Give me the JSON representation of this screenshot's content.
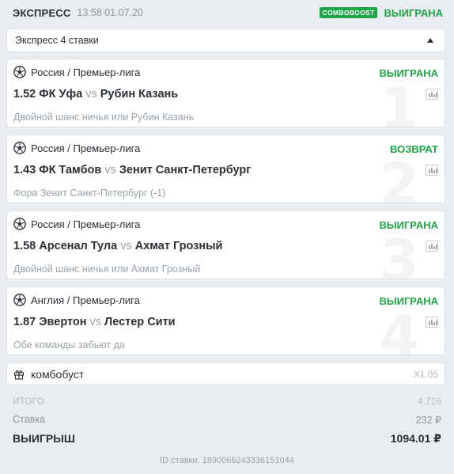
{
  "header": {
    "title": "ЭКСПРЕСС",
    "datetime": "13:58 01.07.20",
    "badge": "COMBOBOOST",
    "result": "ВЫИГРАНА"
  },
  "summary": {
    "label": "Экспресс 4 ставки"
  },
  "events": [
    {
      "index": "1",
      "league": "Россия / Премьер-лига",
      "status": "ВЫИГРАНА",
      "odds": "1.52",
      "home": "ФК Уфа",
      "vs": "vs",
      "away": "Рубин Казань",
      "market": "Двойной шанс ничья или Рубин Казань"
    },
    {
      "index": "2",
      "league": "Россия / Премьер-лига",
      "status": "ВОЗВРАТ",
      "odds": "1.43",
      "home": "ФК Тамбов",
      "vs": "vs",
      "away": "Зенит Санкт-Петербург",
      "market": "Фора Зенит Санкт-Петербург (-1)"
    },
    {
      "index": "3",
      "league": "Россия / Премьер-лига",
      "status": "ВЫИГРАНА",
      "odds": "1.58",
      "home": "Арсенал Тула",
      "vs": "vs",
      "away": "Ахмат Грозный",
      "market": "Двойной шанс ничья или Ахмат Грозный"
    },
    {
      "index": "4",
      "league": "Англия / Премьер-лига",
      "status": "ВЫИГРАНА",
      "odds": "1.87",
      "home": "Эвертон",
      "vs": "vs",
      "away": "Лестер Сити",
      "market": "Обе команды забьют да"
    }
  ],
  "combo": {
    "label": "комбобуст",
    "multiplier": "X1.05"
  },
  "totals": {
    "total_label": "ИТОГО",
    "total_value": "4.716",
    "stake_label": "Ставка",
    "stake_value": "232 ₽",
    "win_label": "ВЫИГРЫШ",
    "win_value": "1094.01 ₽"
  },
  "bet_id": "ID ставки: 1890066243336151044",
  "colors": {
    "win": "#1ea548",
    "background": "#eaedf0",
    "text": "#2b3036",
    "muted": "#9aa2aa"
  },
  "icons": {
    "sport": "soccer-ball-icon",
    "stats": "stats-icon",
    "gift": "gift-icon",
    "toggle": "chevron-up-icon"
  }
}
